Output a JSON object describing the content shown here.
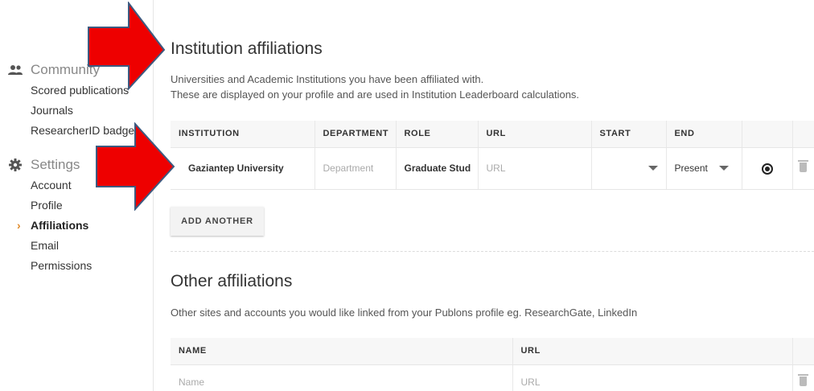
{
  "sidebar": {
    "community": {
      "label": "Community",
      "items": [
        "Scored publications",
        "Journals",
        "ResearcherID badge"
      ]
    },
    "settings": {
      "label": "Settings",
      "items": [
        "Account",
        "Profile",
        "Affiliations",
        "Email",
        "Permissions"
      ],
      "active": "Affiliations"
    }
  },
  "institution": {
    "title": "Institution affiliations",
    "desc_line1": "Universities and Academic Institutions you have been affiliated with.",
    "desc_line2": "These are displayed on your profile and are used in Institution Leaderboard calculations.",
    "columns": [
      "INSTITUTION",
      "DEPARTMENT",
      "ROLE",
      "URL",
      "START",
      "END"
    ],
    "row": {
      "institution": "Gaziantep University",
      "department_placeholder": "Department",
      "role": "Graduate Stud",
      "url_placeholder": "URL",
      "start": "",
      "end": "Present"
    },
    "add_button": "ADD ANOTHER"
  },
  "other": {
    "title": "Other affiliations",
    "desc": "Other sites and accounts you would like linked from your Publons profile eg. ResearchGate, LinkedIn",
    "columns": [
      "NAME",
      "URL"
    ],
    "row": {
      "name_placeholder": "Name",
      "url_placeholder": "URL"
    }
  },
  "colors": {
    "arrow_fill": "#ee0000",
    "arrow_stroke": "#3d5a80",
    "active_caret": "#e08a2a"
  }
}
